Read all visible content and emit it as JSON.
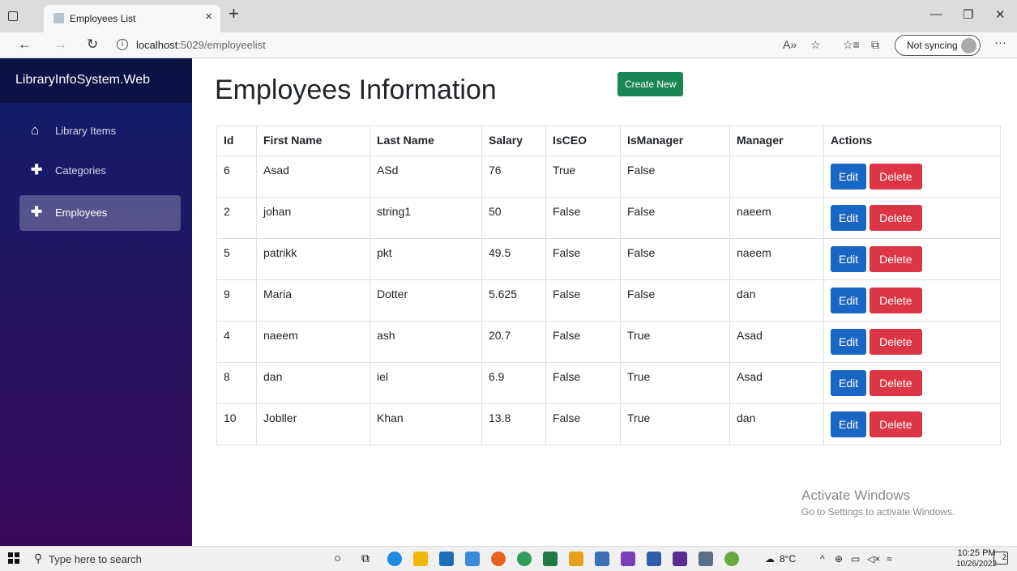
{
  "browser": {
    "tab_title": "Employees List",
    "tab_close": "×",
    "new_tab": "+",
    "url_host": "localhost",
    "url_path": ":5029/employeelist",
    "sync_label": "Not syncing",
    "more": "···"
  },
  "sidebar": {
    "brand": "LibraryInfoSystem.Web",
    "items": [
      {
        "label": "Library Items",
        "icon": "home-icon",
        "glyph": "⌂"
      },
      {
        "label": "Categories",
        "icon": "plus-icon",
        "glyph": "✚"
      },
      {
        "label": "Employees",
        "icon": "plus-icon",
        "glyph": "✚"
      }
    ]
  },
  "main": {
    "title": "Employees Information",
    "create_label": "Create New",
    "headers": [
      "Id",
      "First Name",
      "Last Name",
      "Salary",
      "IsCEO",
      "IsManager",
      "Manager",
      "Actions"
    ],
    "rows": [
      [
        "6",
        "Asad",
        "ASd",
        "76",
        "True",
        "False",
        ""
      ],
      [
        "2",
        "johan",
        "string1",
        "50",
        "False",
        "False",
        "naeem"
      ],
      [
        "5",
        "patrikk",
        "pkt",
        "49.5",
        "False",
        "False",
        "naeem"
      ],
      [
        "9",
        "Maria",
        "Dotter",
        "5.625",
        "False",
        "False",
        "dan"
      ],
      [
        "4",
        "naeem",
        "ash",
        "20.7",
        "False",
        "True",
        "Asad"
      ],
      [
        "8",
        "dan",
        "iel",
        "6.9",
        "False",
        "True",
        "Asad"
      ],
      [
        "10",
        "Jobller",
        "Khan",
        "13.8",
        "False",
        "True",
        "dan"
      ]
    ],
    "edit_label": "Edit",
    "delete_label": "Delete"
  },
  "watermark": {
    "line1": "Activate Windows",
    "line2": "Go to Settings to activate Windows."
  },
  "taskbar": {
    "search_placeholder": "Type here to search",
    "weather": "8°C",
    "time": "10:25 PM",
    "date": "10/26/2022",
    "notifications": "2"
  },
  "colors": {
    "success": "#198754",
    "primary": "#1a66c4",
    "danger": "#dc3545"
  }
}
